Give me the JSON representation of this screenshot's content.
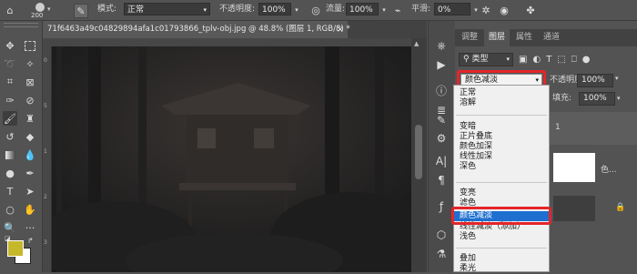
{
  "options_bar": {
    "brush_size": "200",
    "mode_label": "模式:",
    "mode_value": "正常",
    "opacity_label": "不透明度:",
    "opacity_value": "100%",
    "flow_label": "流量:",
    "flow_value": "100%",
    "smooth_label": "平滑:",
    "smooth_value": "0%"
  },
  "document": {
    "tab_title": "71f6463a49c04829894afa1c01793866_tplv-obj.jpg @ 48.8% (图层 1, RGB/8) *",
    "close_glyph": "×",
    "ruler_marks": {
      "r1": "0",
      "r2": "5",
      "r3": "1",
      "r4": "2",
      "r5": "3"
    }
  },
  "layers_panel": {
    "tabs": [
      "调整",
      "图层",
      "属性",
      "通道"
    ],
    "active_tab": "图层",
    "filter_kind": "类型",
    "blend_mode_value": "颜色减淡",
    "opacity_label": "不透明度:",
    "opacity_value": "100%",
    "fill_label": "填充:",
    "fill_value": "100%",
    "layer1_partial": "1",
    "layer2_partial": "色..."
  },
  "blend_dropdown": {
    "groups": [
      [
        "正常",
        "溶解"
      ],
      [
        "变暗",
        "正片叠底",
        "颜色加深",
        "线性加深",
        "深色"
      ],
      [
        "变亮",
        "滤色",
        "颜色减淡",
        "线性减淡（添加）",
        "浅色"
      ],
      [
        "叠加",
        "柔光"
      ]
    ],
    "highlighted": "颜色减淡"
  },
  "colors": {
    "foreground": "#c5b82a",
    "background": "#ffffff",
    "highlight": "#1e6fd0",
    "annotation_red": "#e3262a"
  }
}
